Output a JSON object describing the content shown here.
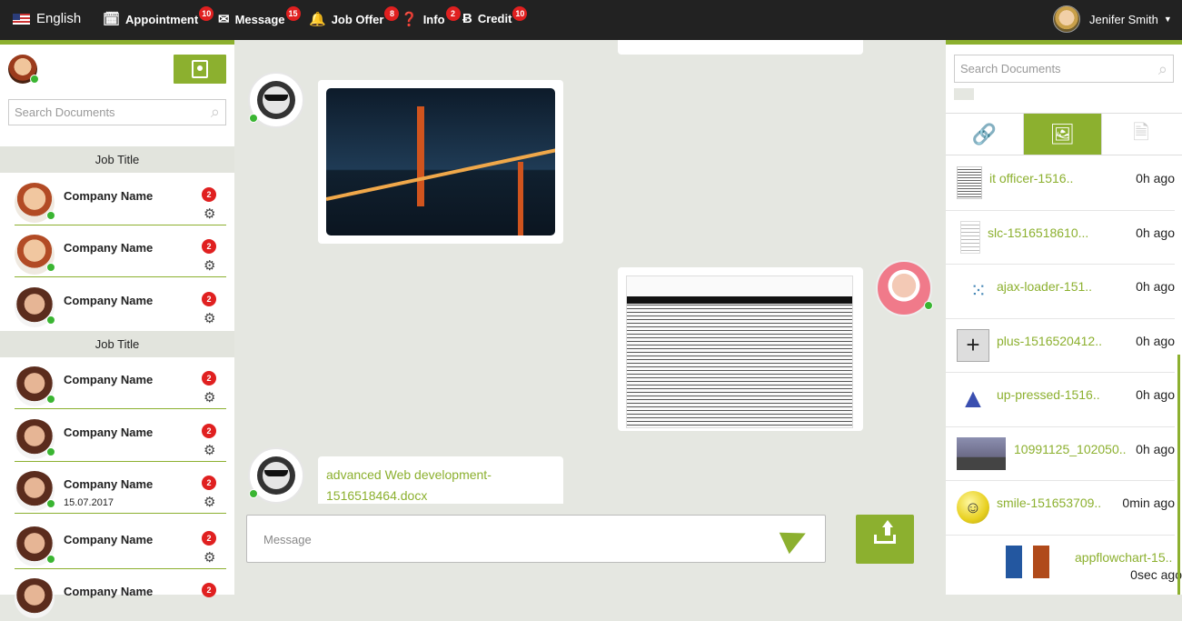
{
  "topbar": {
    "language": "English",
    "nav": [
      {
        "label": "Appointment",
        "badge": "10",
        "icon": "calendar-icon"
      },
      {
        "label": "Message",
        "badge": "15",
        "icon": "envelope-icon"
      },
      {
        "label": "Job Offer",
        "badge": "8",
        "icon": "bell-icon"
      },
      {
        "label": "Info",
        "badge": "2",
        "icon": "question-icon"
      },
      {
        "label": "Credit",
        "badge": "10",
        "icon": "bitcoin-icon"
      }
    ],
    "user_name": "Jenifer Smith"
  },
  "left": {
    "search_placeholder": "Search Documents",
    "groups": [
      "Job Title",
      "Job Title"
    ],
    "contacts": [
      {
        "name": "Company Name",
        "badge": "2",
        "date": ""
      },
      {
        "name": "Company Name",
        "badge": "2",
        "date": ""
      },
      {
        "name": "Company Name",
        "badge": "2",
        "date": ""
      },
      {
        "name": "Company Name",
        "badge": "2",
        "date": ""
      },
      {
        "name": "Company Name",
        "badge": "2",
        "date": ""
      },
      {
        "name": "Company Name",
        "badge": "2",
        "date": "15.07.2017"
      },
      {
        "name": "Company Name",
        "badge": "2",
        "date": ""
      },
      {
        "name": "Company Name",
        "badge": "2",
        "date": ""
      }
    ]
  },
  "chat": {
    "file_message": "advanced Web development-1516518464.docx",
    "message_placeholder": "Message"
  },
  "right": {
    "search_placeholder": "Search Documents",
    "files": [
      {
        "name": "it officer-1516..",
        "time": "0h ago"
      },
      {
        "name": "slc-1516518610...",
        "time": "0h ago"
      },
      {
        "name": "ajax-loader-151..",
        "time": "0h ago"
      },
      {
        "name": "plus-1516520412..",
        "time": "0h ago"
      },
      {
        "name": "up-pressed-1516..",
        "time": "0h ago"
      },
      {
        "name": "10991125_102050..",
        "time": "0h ago"
      },
      {
        "name": "smile-151653709..",
        "time": "0min ago"
      },
      {
        "name": "appflowchart-15..",
        "time": "0sec ago"
      }
    ]
  },
  "colors": {
    "accent": "#8cb02f",
    "badge": "#e02020",
    "topbar": "#222222",
    "online": "#3ab532"
  }
}
